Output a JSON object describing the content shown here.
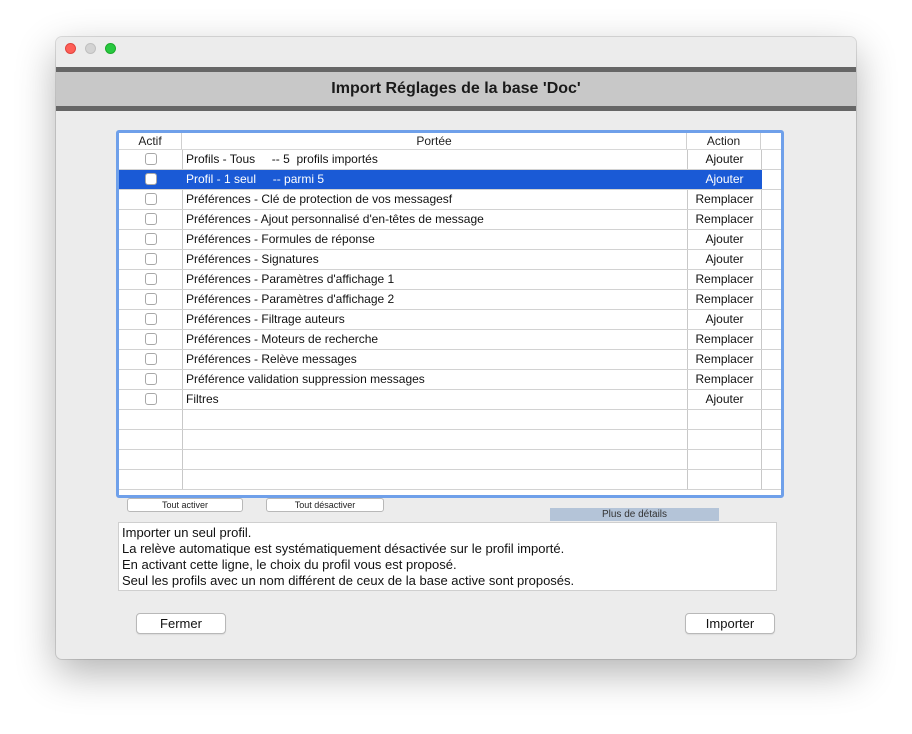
{
  "header": {
    "title": "Import Réglages de la base 'Doc'"
  },
  "table": {
    "columns": {
      "actif": "Actif",
      "portee": "Portée",
      "action": "Action"
    },
    "rows": [
      {
        "checked": false,
        "portee": "Profils - Tous     -- 5  profils importés",
        "action": "Ajouter",
        "selected": false
      },
      {
        "checked": false,
        "portee": "Profil - 1 seul     -- parmi 5",
        "action": "Ajouter",
        "selected": true
      },
      {
        "checked": false,
        "portee": "Préférences - Clé de protection de vos messagesf",
        "action": "Remplacer",
        "selected": false
      },
      {
        "checked": false,
        "portee": "Préférences - Ajout personnalisé d'en-têtes de message",
        "action": "Remplacer",
        "selected": false
      },
      {
        "checked": false,
        "portee": "Préférences - Formules de réponse",
        "action": "Ajouter",
        "selected": false
      },
      {
        "checked": false,
        "portee": "Préférences - Signatures",
        "action": "Ajouter",
        "selected": false
      },
      {
        "checked": false,
        "portee": "Préférences - Paramètres d'affichage 1",
        "action": "Remplacer",
        "selected": false
      },
      {
        "checked": false,
        "portee": "Préférences - Paramètres d'affichage 2",
        "action": "Remplacer",
        "selected": false
      },
      {
        "checked": false,
        "portee": "Préférences - Filtrage auteurs",
        "action": "Ajouter",
        "selected": false
      },
      {
        "checked": false,
        "portee": "Préférences - Moteurs de recherche",
        "action": "Remplacer",
        "selected": false
      },
      {
        "checked": false,
        "portee": "Préférences - Relève messages",
        "action": "Remplacer",
        "selected": false
      },
      {
        "checked": false,
        "portee": "Préférence validation suppression messages",
        "action": "Remplacer",
        "selected": false
      },
      {
        "checked": false,
        "portee": "Filtres",
        "action": "Ajouter",
        "selected": false
      }
    ]
  },
  "controls": {
    "activate_all": "Tout activer",
    "deactivate_all": "Tout désactiver",
    "more_details": "Plus de détails"
  },
  "description": {
    "lines": [
      "Importer un seul profil.",
      "La relève automatique est systématiquement désactivée sur le profil importé.",
      "En activant cette ligne, le choix du profil vous est proposé.",
      "Seul les profils avec un nom différent de ceux de la base active sont proposés."
    ]
  },
  "footer": {
    "close_label": "Fermer",
    "import_label": "Importer"
  },
  "colors": {
    "selection": "#1a5ad6",
    "focus_ring": "#6fa0ea",
    "header_band": "#c8c8c8"
  }
}
